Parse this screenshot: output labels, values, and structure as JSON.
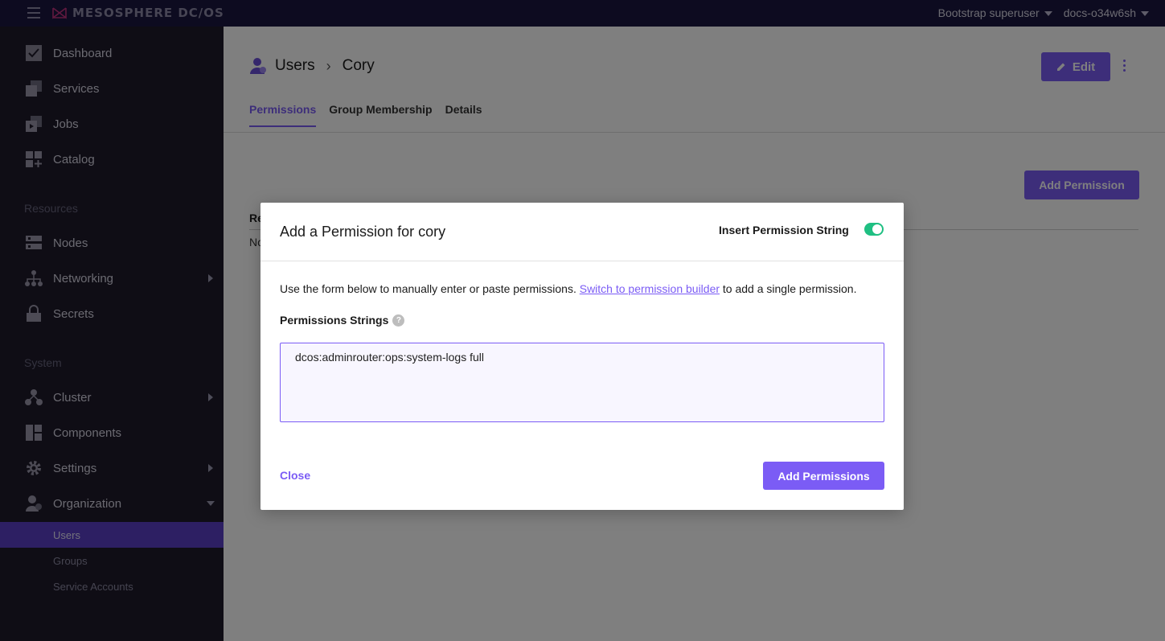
{
  "topbar": {
    "logo_text": "MESOSPHERE DC/OS",
    "user": "Bootstrap superuser",
    "cluster": "docs-o34w6sh"
  },
  "sidebar": {
    "items": [
      {
        "label": "Dashboard",
        "icon": "dashboard-icon"
      },
      {
        "label": "Services",
        "icon": "services-icon"
      },
      {
        "label": "Jobs",
        "icon": "jobs-icon"
      },
      {
        "label": "Catalog",
        "icon": "catalog-icon"
      }
    ],
    "resources_heading": "Resources",
    "resources": [
      {
        "label": "Nodes",
        "icon": "nodes-icon"
      },
      {
        "label": "Networking",
        "icon": "networking-icon"
      },
      {
        "label": "Secrets",
        "icon": "secrets-icon"
      }
    ],
    "system_heading": "System",
    "system": [
      {
        "label": "Cluster",
        "icon": "cluster-icon"
      },
      {
        "label": "Components",
        "icon": "components-icon"
      },
      {
        "label": "Settings",
        "icon": "gear-icon"
      },
      {
        "label": "Organization",
        "icon": "organization-icon"
      }
    ],
    "org_sub": [
      {
        "label": "Users"
      },
      {
        "label": "Groups"
      },
      {
        "label": "Service Accounts"
      }
    ]
  },
  "main": {
    "breadcrumb": {
      "root": "Users",
      "current": "Cory"
    },
    "edit_label": "Edit",
    "tabs": [
      {
        "label": "Permissions"
      },
      {
        "label": "Group Membership"
      },
      {
        "label": "Details"
      }
    ],
    "add_permission_label": "Add Permission",
    "table_head_partial": "Re",
    "table_empty_partial": "No"
  },
  "modal": {
    "title": "Add a Permission for cory",
    "toggle_label": "Insert Permission String",
    "description_before": "Use the form below to manually enter or paste permissions.",
    "description_link": "Switch to permission builder",
    "description_after": "to add a single permission.",
    "field_label": "Permissions Strings",
    "help_glyph": "?",
    "textarea_value": "dcos:adminrouter:ops:system-logs full",
    "close_label": "Close",
    "submit_label": "Add Permissions"
  },
  "colors": {
    "accent": "#7b5cf5",
    "toggle_on": "#1fbf82",
    "sidebar_bg": "#1e1b2b",
    "topbar_bg": "#1b1640"
  }
}
